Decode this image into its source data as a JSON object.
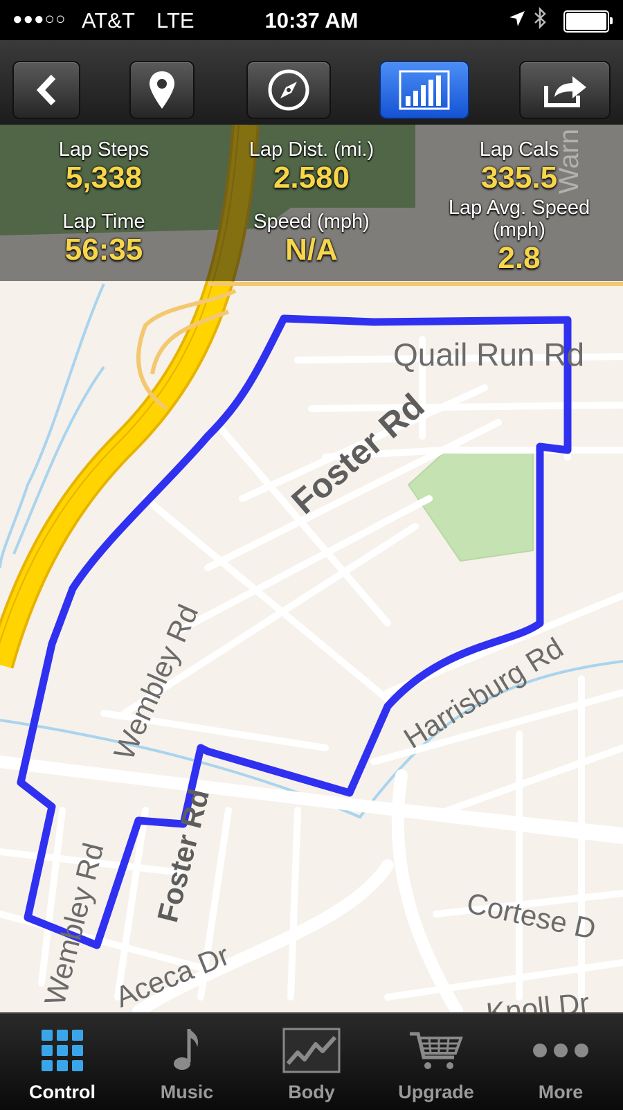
{
  "status_bar": {
    "signal": "●●●○○",
    "carrier": "AT&T",
    "network": "LTE",
    "time": "10:37 AM",
    "battery_level": 1.0
  },
  "toolbar": {
    "buttons": [
      {
        "name": "back",
        "icon": "chevron-left-icon"
      },
      {
        "name": "location",
        "icon": "map-pin-icon"
      },
      {
        "name": "compass",
        "icon": "compass-icon"
      },
      {
        "name": "stats",
        "icon": "bar-chart-icon",
        "active": true
      },
      {
        "name": "share",
        "icon": "share-icon"
      }
    ]
  },
  "stats": {
    "lap_steps": {
      "label": "Lap Steps",
      "value": "5,338"
    },
    "lap_distance": {
      "label": "Lap Dist. (mi.)",
      "value": "2.580"
    },
    "lap_calories": {
      "label": "Lap Cals",
      "value": "335.5"
    },
    "lap_time": {
      "label": "Lap Time",
      "value": "56:35"
    },
    "speed": {
      "label": "Speed (mph)",
      "value": "N/A"
    },
    "lap_avg_speed": {
      "label": "Lap Avg. Speed (mph)",
      "value": "2.8"
    }
  },
  "map": {
    "streets": {
      "quail_run": "Quail Run Rd",
      "foster_main": "Foster Rd",
      "wembley": "Wembley Rd",
      "harrisburg": "Harrisburg Rd",
      "foster_south": "Foster Rd",
      "wembley_south": "Wembley Rd",
      "aceca": "Aceca Dr",
      "cortese": "Cortese D",
      "knoll": "Knoll Dr",
      "warn": "Warn"
    },
    "route_color": "#3030f0",
    "park_color": "#c5e3b2",
    "highway_color": "#ffd400"
  },
  "tabbar": {
    "tabs": [
      {
        "label": "Control",
        "icon": "grid-icon",
        "active": true
      },
      {
        "label": "Music",
        "icon": "music-note-icon"
      },
      {
        "label": "Body",
        "icon": "body-graph-icon"
      },
      {
        "label": "Upgrade",
        "icon": "cart-icon"
      },
      {
        "label": "More",
        "icon": "more-dots-icon"
      }
    ]
  }
}
